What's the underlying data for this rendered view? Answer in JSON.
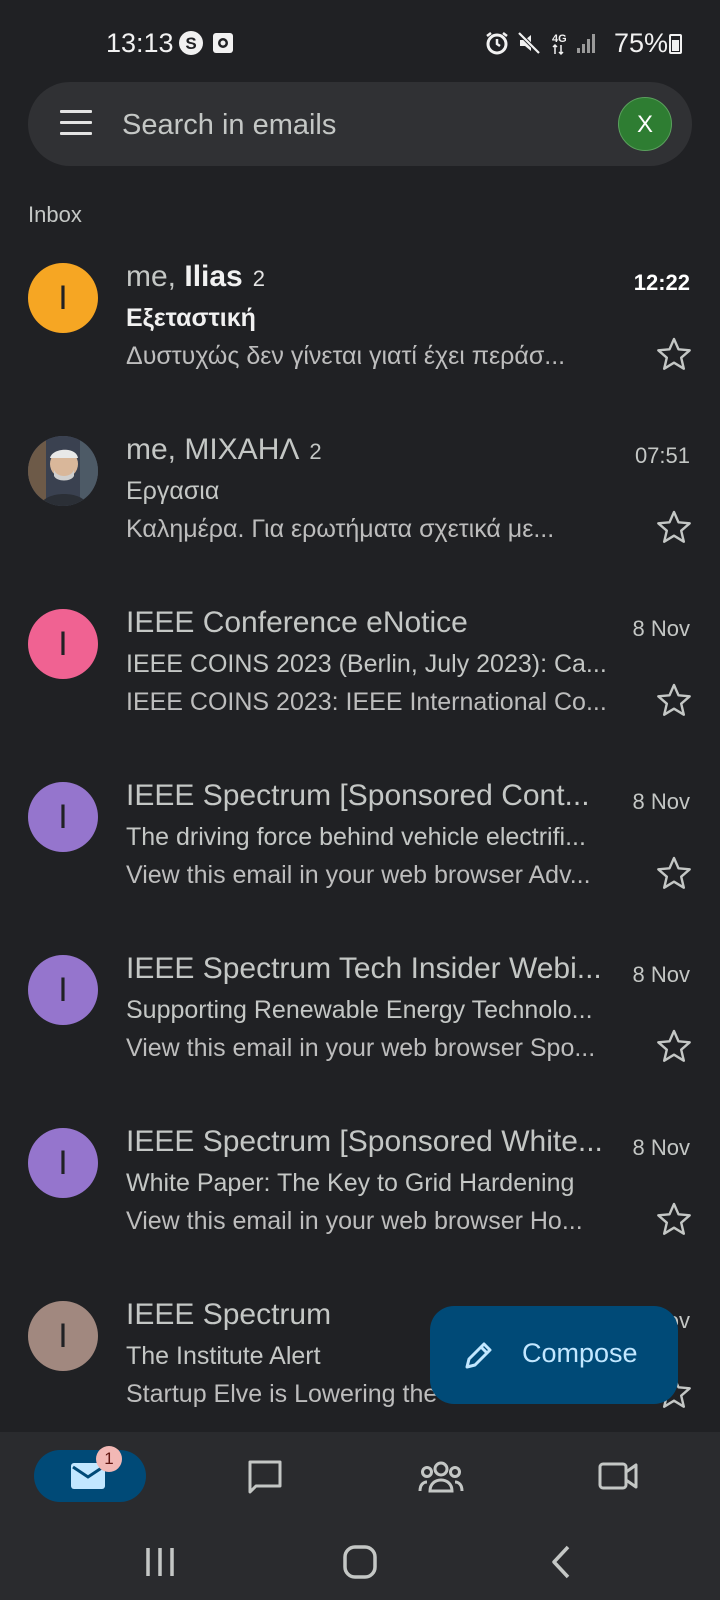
{
  "status_bar": {
    "time": "13:13",
    "battery": "75%",
    "icons": [
      "s-icon",
      "screenshot-icon",
      "alarm-icon",
      "mute-icon",
      "4g-icon",
      "signal-icon",
      "battery-icon"
    ]
  },
  "search": {
    "placeholder": "Search in emails",
    "account_initial": "X",
    "account_color": "#2e7d32"
  },
  "section_label": "Inbox",
  "emails": [
    {
      "sender_prefix": "me, ",
      "sender_bold": "Ilias",
      "count": "2",
      "date": "12:22",
      "subject": "Εξεταστική",
      "snippet": "Δυστυχώς δεν γίνεται γιατί έχει περάσ...",
      "initial": "I",
      "color": "#f6a623",
      "unread": true
    },
    {
      "sender_prefix": "me, ΜΙΧΑΗΛ",
      "sender_bold": "",
      "count": "2",
      "date": "07:51",
      "subject": "Εργασια",
      "snippet": "Καλημέρα. Για ερωτήματα σχετικά με...",
      "initial": "",
      "color": "#556070",
      "unread": false,
      "photo": true
    },
    {
      "sender_prefix": "IEEE Conference eNotice",
      "sender_bold": "",
      "count": "",
      "date": "8 Nov",
      "subject": "IEEE COINS 2023 (Berlin, July 2023): Ca...",
      "snippet": "IEEE COINS 2023: IEEE International Co...",
      "initial": "I",
      "color": "#f06292",
      "unread": false
    },
    {
      "sender_prefix": "IEEE Spectrum [Sponsored Cont...",
      "sender_bold": "",
      "count": "",
      "date": "8 Nov",
      "subject": "The driving force behind vehicle electrifi...",
      "snippet": "View this email in your web browser Adv...",
      "initial": "I",
      "color": "#9575cd",
      "unread": false
    },
    {
      "sender_prefix": "IEEE Spectrum Tech Insider Webi...",
      "sender_bold": "",
      "count": "",
      "date": "8 Nov",
      "subject": "Supporting Renewable Energy Technolo...",
      "snippet": "View this email in your web browser Spo...",
      "initial": "I",
      "color": "#9575cd",
      "unread": false
    },
    {
      "sender_prefix": "IEEE Spectrum [Sponsored White...",
      "sender_bold": "",
      "count": "",
      "date": "8 Nov",
      "subject": "White Paper: The Key to Grid Hardening",
      "snippet": "View this email in your web browser Ho...",
      "initial": "I",
      "color": "#9575cd",
      "unread": false
    },
    {
      "sender_prefix": "IEEE Spectrum",
      "sender_bold": "",
      "count": "",
      "date": "8 Nov",
      "subject": "The Institute Alert",
      "snippet": "Startup Elve is Lowering the Cost of Mill...",
      "initial": "I",
      "color": "#a1887f",
      "unread": false
    }
  ],
  "compose": {
    "label": "Compose"
  },
  "bottom_nav": {
    "items": [
      "mail-icon",
      "chat-icon",
      "spaces-icon",
      "meet-icon"
    ],
    "mail_badge": "1"
  },
  "system_nav": [
    "recents-icon",
    "home-icon",
    "back-icon"
  ]
}
